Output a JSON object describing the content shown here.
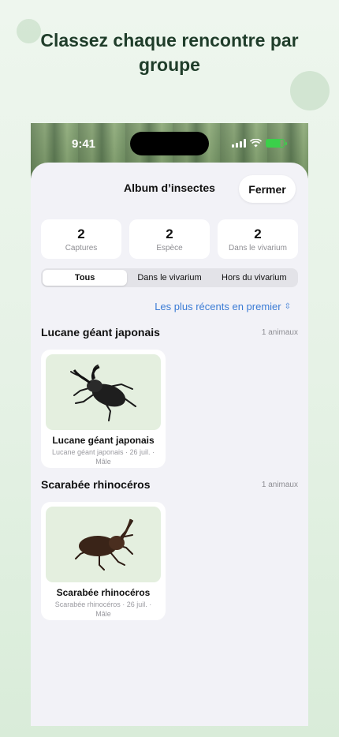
{
  "headline": "Classez chaque rencontre par groupe",
  "status_bar": {
    "time": "9:41"
  },
  "sheet": {
    "title": "Album d’insectes",
    "close_label": "Fermer"
  },
  "stats": [
    {
      "value": "2",
      "label": "Captures"
    },
    {
      "value": "2",
      "label": "Espèce"
    },
    {
      "value": "2",
      "label": "Dans le vivarium"
    }
  ],
  "segments": [
    {
      "label": "Tous",
      "active": true
    },
    {
      "label": "Dans le vivarium",
      "active": false
    },
    {
      "label": "Hors du vivarium",
      "active": false
    }
  ],
  "sort": {
    "label": "Les plus récents en premier",
    "icon": "chevron-up-down-icon"
  },
  "sections": [
    {
      "title": "Lucane géant japonais",
      "count": "1 animaux",
      "cards": [
        {
          "name": "Lucane géant japonais",
          "subtitle": "Lucane géant japonais · 26 juil. · Mâle",
          "icon": "stag-beetle-image"
        }
      ]
    },
    {
      "title": "Scarabée rhinocéros",
      "count": "1 animaux",
      "cards": [
        {
          "name": "Scarabée rhinocéros",
          "subtitle": "Scarabée rhinocéros · 26 juil. · Mâle",
          "icon": "rhinoceros-beetle-image"
        }
      ]
    }
  ],
  "colors": {
    "accent": "#3a7bd5",
    "headline": "#1f3d2a",
    "card_image_bg": "#e4efdf"
  }
}
